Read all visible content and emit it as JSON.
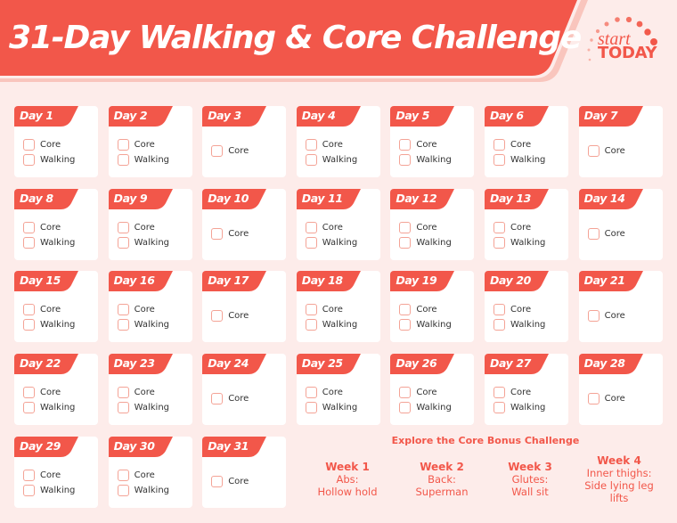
{
  "header": {
    "title": "31-Day Walking & Core Challenge",
    "logo": {
      "top": "start",
      "bottom": "TODAY"
    }
  },
  "colors": {
    "accent": "#f2574a",
    "background": "#fdecea",
    "card": "#ffffff",
    "checkbox_border": "#f4a396"
  },
  "days": [
    {
      "label": "Day 1",
      "tasks": [
        "Core",
        "Walking"
      ]
    },
    {
      "label": "Day 2",
      "tasks": [
        "Core",
        "Walking"
      ]
    },
    {
      "label": "Day 3",
      "tasks": [
        "Core"
      ]
    },
    {
      "label": "Day 4",
      "tasks": [
        "Core",
        "Walking"
      ]
    },
    {
      "label": "Day 5",
      "tasks": [
        "Core",
        "Walking"
      ]
    },
    {
      "label": "Day 6",
      "tasks": [
        "Core",
        "Walking"
      ]
    },
    {
      "label": "Day 7",
      "tasks": [
        "Core"
      ]
    },
    {
      "label": "Day 8",
      "tasks": [
        "Core",
        "Walking"
      ]
    },
    {
      "label": "Day 9",
      "tasks": [
        "Core",
        "Walking"
      ]
    },
    {
      "label": "Day 10",
      "tasks": [
        "Core"
      ]
    },
    {
      "label": "Day 11",
      "tasks": [
        "Core",
        "Walking"
      ]
    },
    {
      "label": "Day 12",
      "tasks": [
        "Core",
        "Walking"
      ]
    },
    {
      "label": "Day 13",
      "tasks": [
        "Core",
        "Walking"
      ]
    },
    {
      "label": "Day 14",
      "tasks": [
        "Core"
      ]
    },
    {
      "label": "Day 15",
      "tasks": [
        "Core",
        "Walking"
      ]
    },
    {
      "label": "Day 16",
      "tasks": [
        "Core",
        "Walking"
      ]
    },
    {
      "label": "Day 17",
      "tasks": [
        "Core"
      ]
    },
    {
      "label": "Day 18",
      "tasks": [
        "Core",
        "Walking"
      ]
    },
    {
      "label": "Day 19",
      "tasks": [
        "Core",
        "Walking"
      ]
    },
    {
      "label": "Day 20",
      "tasks": [
        "Core",
        "Walking"
      ]
    },
    {
      "label": "Day 21",
      "tasks": [
        "Core"
      ]
    },
    {
      "label": "Day 22",
      "tasks": [
        "Core",
        "Walking"
      ]
    },
    {
      "label": "Day 23",
      "tasks": [
        "Core",
        "Walking"
      ]
    },
    {
      "label": "Day 24",
      "tasks": [
        "Core"
      ]
    },
    {
      "label": "Day 25",
      "tasks": [
        "Core",
        "Walking"
      ]
    },
    {
      "label": "Day 26",
      "tasks": [
        "Core",
        "Walking"
      ]
    },
    {
      "label": "Day 27",
      "tasks": [
        "Core",
        "Walking"
      ]
    },
    {
      "label": "Day 28",
      "tasks": [
        "Core"
      ]
    },
    {
      "label": "Day 29",
      "tasks": [
        "Core",
        "Walking"
      ]
    },
    {
      "label": "Day 30",
      "tasks": [
        "Core",
        "Walking"
      ]
    },
    {
      "label": "Day 31",
      "tasks": [
        "Core"
      ]
    }
  ],
  "bonus": {
    "title": "Explore the Core Bonus Challenge",
    "weeks": [
      {
        "title": "Week 1",
        "lines": [
          "Abs:",
          "Hollow hold"
        ]
      },
      {
        "title": "Week 2",
        "lines": [
          "Back:",
          "Superman"
        ]
      },
      {
        "title": "Week 3",
        "lines": [
          "Glutes:",
          "Wall sit"
        ]
      },
      {
        "title": "Week 4",
        "lines": [
          "Inner thighs:",
          "Side lying leg",
          "lifts"
        ]
      }
    ]
  }
}
